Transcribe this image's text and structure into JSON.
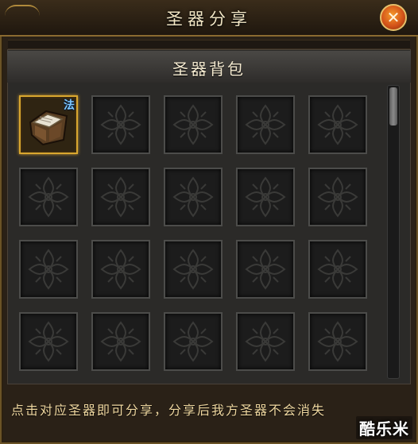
{
  "window": {
    "title": "圣器分享",
    "close_icon": "close-x-icon"
  },
  "backpack": {
    "title": "圣器背包",
    "columns": 5,
    "visible_rows": 4,
    "slots": [
      {
        "filled": true,
        "item_icon": "holy-relic-book-icon",
        "badge": "法"
      },
      {
        "filled": false
      },
      {
        "filled": false
      },
      {
        "filled": false
      },
      {
        "filled": false
      },
      {
        "filled": false
      },
      {
        "filled": false
      },
      {
        "filled": false
      },
      {
        "filled": false
      },
      {
        "filled": false
      },
      {
        "filled": false
      },
      {
        "filled": false
      },
      {
        "filled": false
      },
      {
        "filled": false
      },
      {
        "filled": false
      },
      {
        "filled": false
      },
      {
        "filled": false
      },
      {
        "filled": false
      },
      {
        "filled": false
      },
      {
        "filled": false
      }
    ],
    "scroll_position": 0
  },
  "footer": {
    "hint": "点击对应圣器即可分享，分享后我方圣器不会消失"
  },
  "watermark": {
    "text": "酷乐米"
  },
  "colors": {
    "title_text": "#f2e6c4",
    "hint_text": "#f0d8a0",
    "slot_border_selected": "#d9a72f",
    "close_button": "#d4541a",
    "badge": "#7ec8ff"
  }
}
